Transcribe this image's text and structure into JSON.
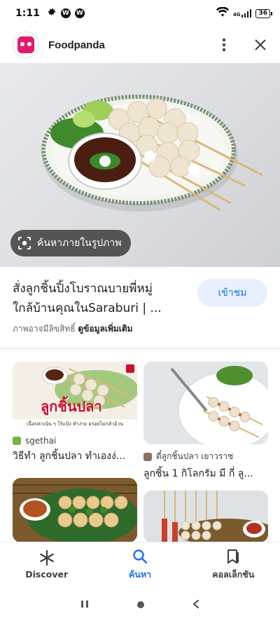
{
  "status_bar": {
    "time": "1:11",
    "battery": "36",
    "network": "4G"
  },
  "app_bar": {
    "title": "Foodpanda",
    "brand_color": "#e21b70"
  },
  "lens": {
    "chip_label": "ค้นหาภายในรูปภาพ"
  },
  "result": {
    "title_line1": "สั่งลูกชิ้นปิ้งโบราณบายพี่หมู่",
    "title_line2": "ใกล้บ้านคุณในSaraburi | ...",
    "visit_label": "เข้าชม",
    "copyright_text": "ภาพอาจมีลิขสิทธิ์",
    "more_info_label": "ดูข้อมูลเพิ่มเติม"
  },
  "related": [
    {
      "thumb_text": "ลูกชิ้นปลา",
      "thumb_subtext": "เนื้อปลาเน้น ๆ ไร้แป้ง ทำง่าย อร่อยไม่กลัวอ้วน",
      "source": "sgethai",
      "caption": "วิธีทำ ลูกชิ้นปลา ทำเองง่..."
    },
    {
      "source": "ตี๋ลูกชิ้นปลา เยาวราช",
      "caption": "ลูกชิ้น 1 กิโลกรัม มี กี่ ลู..."
    },
    {},
    {}
  ],
  "bottom_nav": {
    "items": [
      {
        "label": "Discover",
        "icon": "asterisk-icon"
      },
      {
        "label": "ค้นหา",
        "icon": "search-icon"
      },
      {
        "label": "คอลเล็กชัน",
        "icon": "bookmark-icon"
      }
    ],
    "active_index": 1,
    "accent_color": "#1a73e8"
  }
}
